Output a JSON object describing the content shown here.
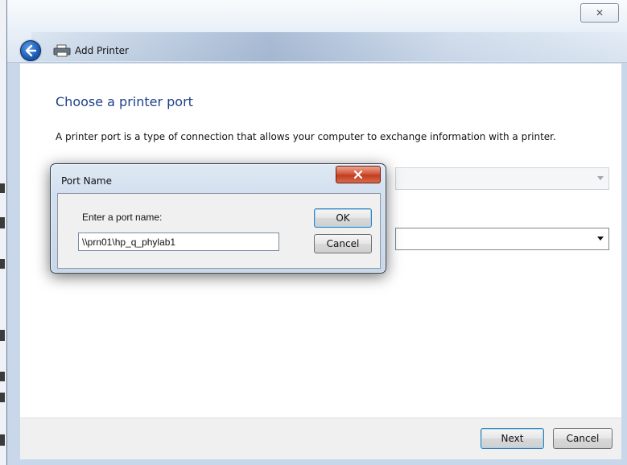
{
  "window": {
    "title": "Add Printer",
    "close_glyph": "✕",
    "back_icon": "back-arrow-icon",
    "app_icon": "printer-icon"
  },
  "page": {
    "heading": "Choose a printer port",
    "description": "A printer port is a type of connection that allows your computer to exchange information with a printer."
  },
  "footer": {
    "next_label": "Next",
    "cancel_label": "Cancel"
  },
  "dialog": {
    "title": "Port Name",
    "prompt": "Enter a port name:",
    "port_value": "\\\\prn01\\hp_q_phylab1",
    "ok_label": "OK",
    "cancel_label": "Cancel",
    "close_glyph": "✕"
  },
  "colors": {
    "heading": "#1e3f8a",
    "dialog_close": "#c23d1f",
    "back_button": "#1f5fb8"
  }
}
